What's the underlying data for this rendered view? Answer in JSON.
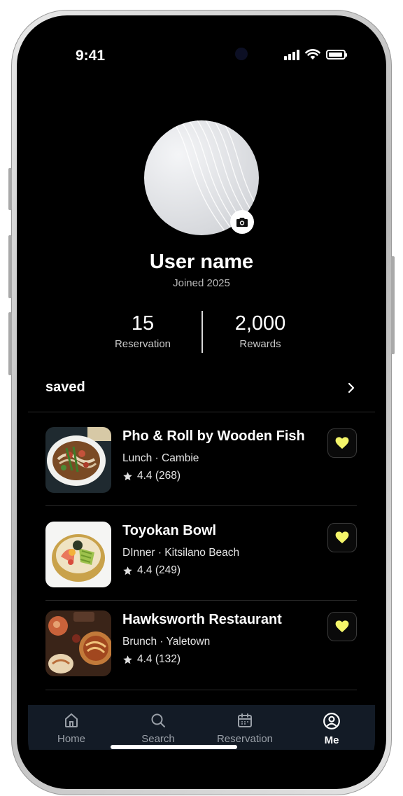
{
  "status_bar": {
    "time": "9:41"
  },
  "profile": {
    "name": "User name",
    "joined": "Joined 2025",
    "camera_icon": "camera-icon"
  },
  "stats": [
    {
      "value": "15",
      "label": "Reservation"
    },
    {
      "value": "2,000",
      "label": "Rewards"
    }
  ],
  "saved": {
    "title": "saved",
    "items": [
      {
        "name": "Pho & Roll by Wooden Fish",
        "meta": "Lunch · Cambie",
        "rating": "4.4 (268)"
      },
      {
        "name": "Toyokan Bowl",
        "meta": "DInner · Kitsilano Beach",
        "rating": "4.4 (249)"
      },
      {
        "name": "Hawksworth Restaurant",
        "meta": "Brunch · Yaletown",
        "rating": "4.4 (132)"
      }
    ]
  },
  "tabs": [
    {
      "label": "Home",
      "icon": "home-icon"
    },
    {
      "label": "Search",
      "icon": "search-icon"
    },
    {
      "label": "Reservation",
      "icon": "calendar-icon"
    },
    {
      "label": "Me",
      "icon": "profile-icon",
      "active": true
    }
  ],
  "colors": {
    "accent_heart": "#f4f56a",
    "background": "#000000",
    "tabbar": "#131b26"
  }
}
